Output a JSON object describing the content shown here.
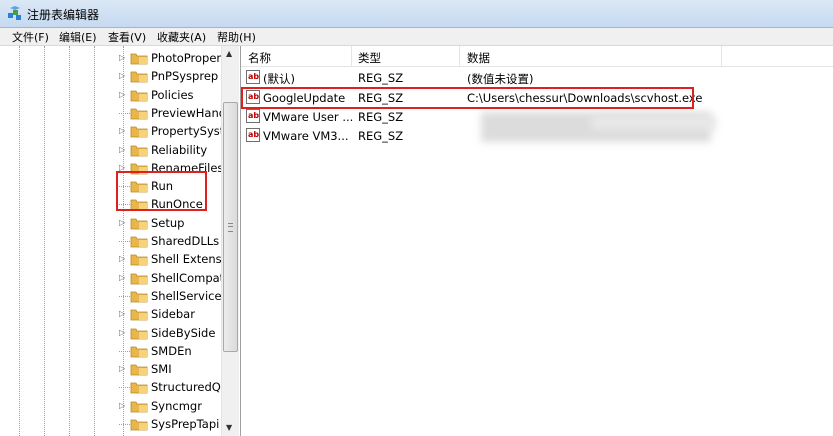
{
  "window": {
    "title": "注册表编辑器"
  },
  "menu": [
    "文件(F)",
    "编辑(E)",
    "查看(V)",
    "收藏夹(A)",
    "帮助(H)"
  ],
  "tree": {
    "items": [
      {
        "label": "PhotoPropert",
        "expandable": true
      },
      {
        "label": "PnPSysprep",
        "expandable": true
      },
      {
        "label": "Policies",
        "expandable": true
      },
      {
        "label": "PreviewHand",
        "expandable": false
      },
      {
        "label": "PropertySyste",
        "expandable": true
      },
      {
        "label": "Reliability",
        "expandable": true
      },
      {
        "label": "RenameFiles",
        "expandable": true
      },
      {
        "label": "Run",
        "expandable": false
      },
      {
        "label": "RunOnce",
        "expandable": false
      },
      {
        "label": "Setup",
        "expandable": true
      },
      {
        "label": "SharedDLLs",
        "expandable": false
      },
      {
        "label": "Shell Extensic",
        "expandable": true
      },
      {
        "label": "ShellCompati",
        "expandable": true
      },
      {
        "label": "ShellServiceC",
        "expandable": false
      },
      {
        "label": "Sidebar",
        "expandable": true
      },
      {
        "label": "SideBySide",
        "expandable": true
      },
      {
        "label": "SMDEn",
        "expandable": false
      },
      {
        "label": "SMI",
        "expandable": true
      },
      {
        "label": "StructuredQu",
        "expandable": false
      },
      {
        "label": "Syncmgr",
        "expandable": true
      },
      {
        "label": "SysPrepTapi",
        "expandable": false
      }
    ]
  },
  "list": {
    "headers": {
      "name": "名称",
      "type": "类型",
      "data": "数据"
    },
    "rows": [
      {
        "name": "(默认)",
        "type": "REG_SZ",
        "data": "(数值未设置)"
      },
      {
        "name": "GoogleUpdate",
        "type": "REG_SZ",
        "data": "C:\\Users\\chessur\\Downloads\\scvhost.exe"
      },
      {
        "name": "VMware User ...",
        "type": "REG_SZ",
        "data": ""
      },
      {
        "name": "VMware VM3...",
        "type": "REG_SZ",
        "data": ""
      }
    ]
  },
  "icons": {
    "value_icon": "ab",
    "folder": "folder-icon",
    "app": "regedit-icon"
  },
  "colors": {
    "highlight_box": "#e0201c",
    "titlebar": "#c5d9f0",
    "folder": "#e8b64a"
  }
}
